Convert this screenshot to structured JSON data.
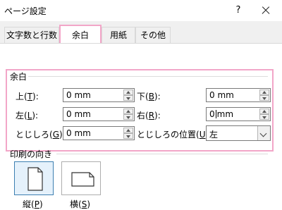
{
  "window": {
    "title": "ページ設定",
    "help_label": "?"
  },
  "tabs": [
    {
      "label": "文字数と行数"
    },
    {
      "label": "余白"
    },
    {
      "label": "用紙"
    },
    {
      "label": "その他"
    }
  ],
  "margins": {
    "group_label": "余白",
    "top": {
      "label_a": "上(",
      "mnemonic": "T",
      "label_b": "):",
      "value": "0 mm"
    },
    "bottom": {
      "label_a": "下(",
      "mnemonic": "B",
      "label_b": "):",
      "value": "0 mm"
    },
    "left": {
      "label_a": "左(",
      "mnemonic": "L",
      "label_b": "):",
      "value": "0 mm"
    },
    "right": {
      "label_a": "右(",
      "mnemonic": "R",
      "label_b": "):",
      "value_a": "0",
      "value_b": "mm"
    },
    "gutter": {
      "label_a": "とじしろ(",
      "mnemonic": "G",
      "label_b": "):",
      "value": "0 mm"
    },
    "gutter_position": {
      "label_a": "とじしろの位置(",
      "mnemonic": "U",
      "label_b": "):",
      "value": "左"
    }
  },
  "orientation": {
    "group_label": "印刷の向き",
    "portrait": {
      "label_a": "縦(",
      "mnemonic": "P",
      "label_b": ")"
    },
    "landscape": {
      "label_a": "横(",
      "mnemonic": "S",
      "label_b": ")"
    }
  },
  "colors": {
    "highlight": "#f2a6c8",
    "selected_border": "#3c7fb1"
  }
}
